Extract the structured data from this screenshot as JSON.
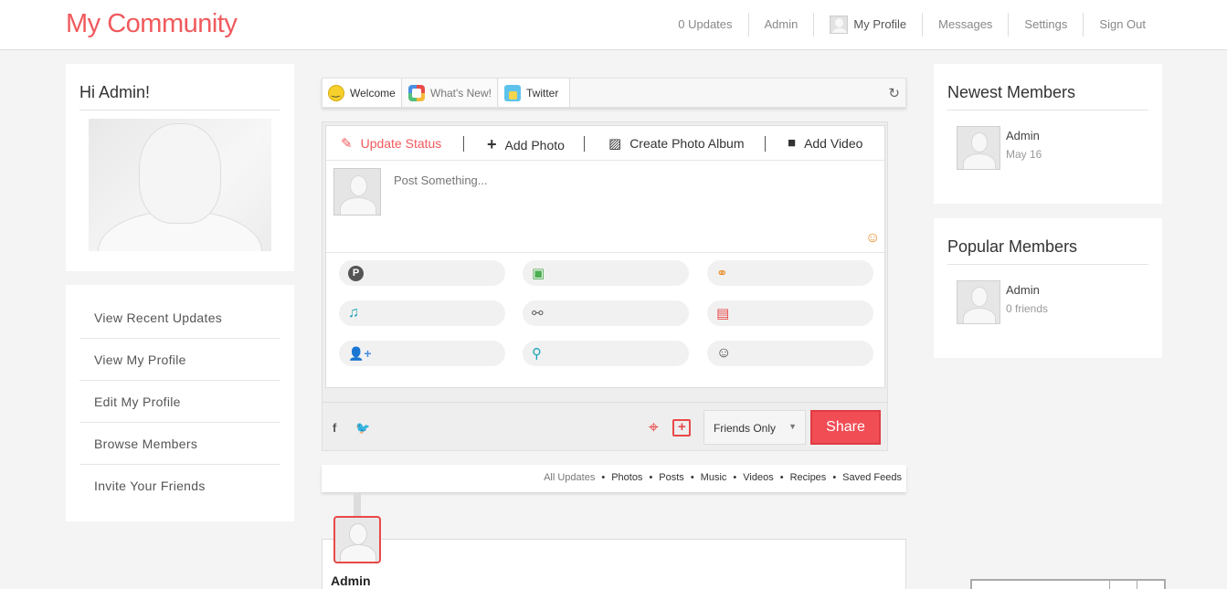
{
  "header": {
    "brand": "My Community",
    "nav": [
      "0 Updates",
      "Admin",
      "My Profile",
      "Messages",
      "Settings",
      "Sign Out"
    ]
  },
  "left": {
    "greeting": "Hi Admin!",
    "menu": [
      "View Recent Updates",
      "View My Profile",
      "Edit My Profile",
      "Browse Members",
      "Invite Your Friends"
    ]
  },
  "tabs": {
    "items": [
      "Welcome",
      "What's New!",
      "Twitter"
    ]
  },
  "composer": {
    "actions": [
      "Update Status",
      "Add Photo",
      "Create Photo Album",
      "Add Video"
    ],
    "placeholder": "Post Something...",
    "attach_icons": [
      "poll-icon",
      "image-icon",
      "link-icon",
      "music-icon",
      "group-link-icon",
      "film-icon",
      "add-person-icon",
      "location-pin-icon",
      "smiley-icon"
    ],
    "privacy": "Friends Only",
    "share": "Share"
  },
  "feed": {
    "filters": [
      "All Updates",
      "Photos",
      "Posts",
      "Music",
      "Videos",
      "Recipes",
      "Saved Feeds"
    ],
    "first_author": "Admin"
  },
  "right": {
    "newest_title": "Newest Members",
    "newest": [
      {
        "name": "Admin",
        "sub": "May 16"
      }
    ],
    "popular_title": "Popular Members",
    "popular": [
      {
        "name": "Admin",
        "sub": "0 friends"
      }
    ]
  },
  "colors": {
    "brand": "#f05a5d",
    "share_button": "#f04d55",
    "accent_icon": "#e94848"
  }
}
